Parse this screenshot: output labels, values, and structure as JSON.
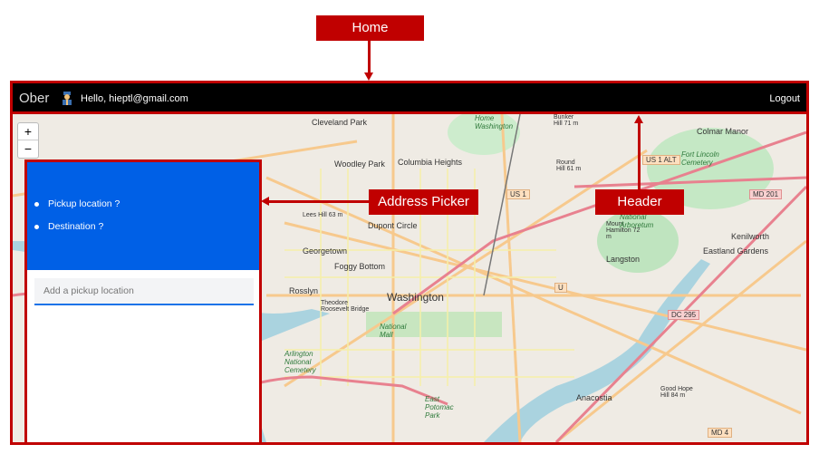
{
  "annotations": {
    "home": "Home",
    "address_picker": "Address Picker",
    "header": "Header",
    "color": "#c00000"
  },
  "header": {
    "brand": "Ober",
    "avatar_icon": "user-avatar-icon",
    "greeting": "Hello, hieptl@gmail.com",
    "logout": "Logout"
  },
  "map": {
    "zoom_in": "+",
    "zoom_out": "−",
    "labels": [
      "Cleveland Park",
      "Woodley Park",
      "Columbia Heights",
      "Dupont Circle",
      "Georgetown",
      "Foggy Bottom",
      "Rosslyn",
      "Washington",
      "Colmar Manor",
      "Kenilworth",
      "Eastland Gardens",
      "Langston",
      "Anacostia",
      "Theodore Roosevelt Bridge",
      "Lees Hill 63 m",
      "Round Hill 61 m",
      "Bunker Hill 71 m",
      "Mount Hamilton 72 m",
      "Good Hope Hill 84 m"
    ],
    "park_labels": [
      "National Mall",
      "Arlington National Cemetery",
      "United States National Arboretum",
      "Fort Lincoln Cemetery",
      "East Potomac Park",
      "Home Washington"
    ],
    "shields": [
      "US 1",
      "US 1 ALT",
      "MD 201",
      "DC 295",
      "MD 4",
      "U"
    ]
  },
  "address_picker": {
    "items": [
      "Pickup location ?",
      "Destination ?"
    ],
    "input_placeholder": "Add a pickup location",
    "accent": "#0060e6"
  }
}
